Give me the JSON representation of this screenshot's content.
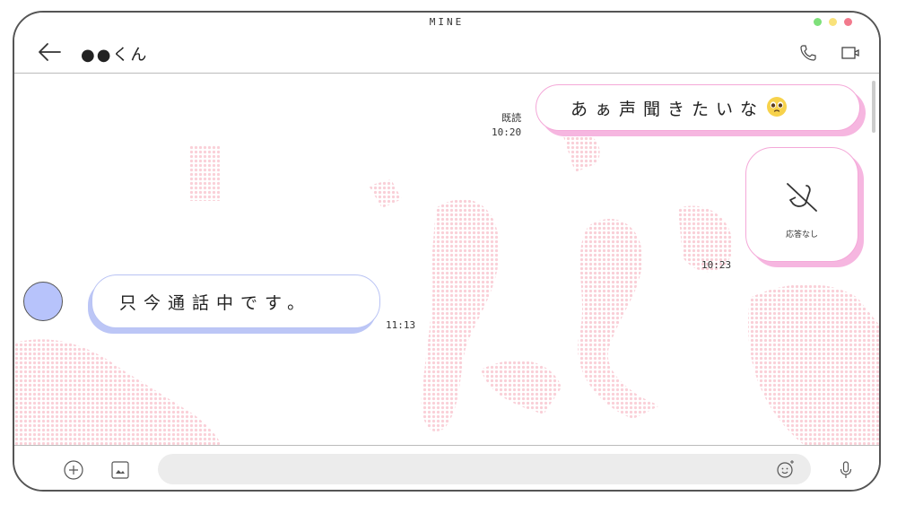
{
  "window": {
    "app_title": "mine",
    "traffic_lights": [
      "#7ee07a",
      "#f9e27a",
      "#f27a8d"
    ]
  },
  "header": {
    "contact_name": "●●くん",
    "back_icon": "arrow-left-icon",
    "call_icon": "phone-icon",
    "video_icon": "video-icon"
  },
  "messages": {
    "outgoing_1": {
      "text": "あぁ声聞きたいな",
      "emoji": "pleading-face",
      "status": "既読",
      "time": "10:20"
    },
    "call": {
      "label": "応答なし",
      "icon": "missed-call-icon",
      "time": "10:23"
    },
    "incoming_1": {
      "text": "只今通話中です。",
      "time": "11:13"
    }
  },
  "input_bar": {
    "add_icon": "plus-circle-icon",
    "image_icon": "image-icon",
    "emoji_icon": "emoji-add-icon",
    "mic_icon": "mic-icon",
    "placeholder": ""
  },
  "colors": {
    "outgoing_accent": "#f6b6e0",
    "incoming_accent": "#bcc6f6",
    "avatar": "#b7c3fb"
  }
}
